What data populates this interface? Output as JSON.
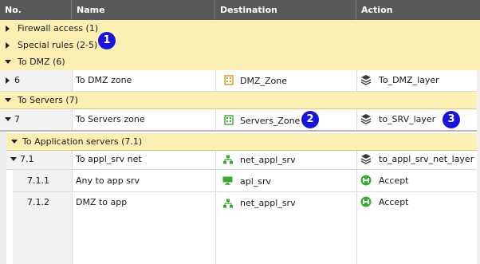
{
  "columns": {
    "no": "No.",
    "name": "Name",
    "destination": "Destination",
    "action": "Action"
  },
  "sections": {
    "firewall": "Firewall access",
    "firewall_count": "(1)",
    "special": "Special rules",
    "special_count": "(2-5)",
    "todmz": "To DMZ",
    "todmz_count": "(6)",
    "toservers": "To Servers",
    "toservers_count": "(7)",
    "toapp": "To Application servers",
    "toapp_count": "(7.1)"
  },
  "rows": [
    {
      "no": "6",
      "name": "To DMZ zone",
      "destination": "DMZ_Zone",
      "action": "To_DMZ_layer"
    },
    {
      "no": "7",
      "name": "To Servers zone",
      "destination": "Servers_Zone",
      "action": "to_SRV_layer"
    },
    {
      "no": "7.1",
      "name": "To appl_srv net",
      "destination": "net_appl_srv",
      "action": "to_appl_srv_net_layer"
    },
    {
      "no": "7.1.1",
      "name": "Any to app srv",
      "destination": "apl_srv",
      "action": "Accept"
    },
    {
      "no": "7.1.2",
      "name": "DMZ to app",
      "destination": "net_appl_srv",
      "action": "Accept"
    }
  ],
  "callouts": [
    "1",
    "2",
    "3"
  ],
  "colors": {
    "header_bg": "#595959",
    "section_bg": "#fbefb3",
    "callout_bg": "#1a14d6",
    "accept_green": "#3aa935",
    "zone_orange": "#d99a1e",
    "zone_green": "#3aa935"
  },
  "icons": {
    "dmz_zone": "zone-icon",
    "servers_zone": "zone-icon",
    "network": "network-icon",
    "host": "host-icon",
    "layer": "layers-icon",
    "accept": "accept-icon"
  }
}
